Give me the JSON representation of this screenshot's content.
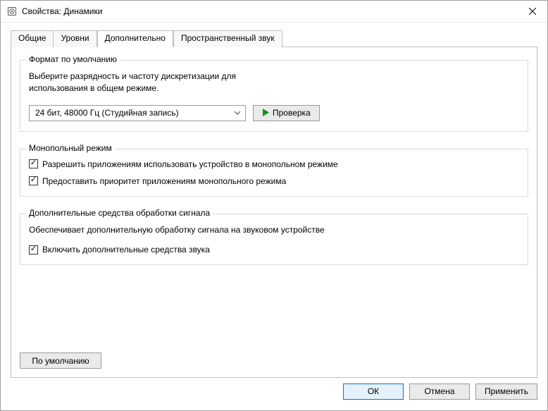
{
  "window": {
    "title": "Свойства: Динамики"
  },
  "tabs": {
    "general": "Общие",
    "levels": "Уровни",
    "advanced": "Дополнительно",
    "spatial": "Пространственный звук"
  },
  "group_format": {
    "legend": "Формат по умолчанию",
    "desc_line1": "Выберите разрядность и частоту дискретизации для",
    "desc_line2": "использования в общем режиме.",
    "selected": "24 бит, 48000 Гц (Студийная запись)",
    "test_btn": "Проверка"
  },
  "group_exclusive": {
    "legend": "Монопольный режим",
    "opt_allow": "Разрешить приложениям использовать устройство в монопольном режиме",
    "opt_priority": "Предоставить приоритет приложениям монопольного режима"
  },
  "group_enh": {
    "legend": "Дополнительные средства обработки сигнала",
    "desc": "Обеспечивает дополнительную обработку сигнала на звуковом устройстве",
    "opt_enable": "Включить дополнительные средства звука"
  },
  "panel_footer": {
    "restore_defaults": "По умолчанию"
  },
  "buttons": {
    "ok": "ОК",
    "cancel": "Отмена",
    "apply": "Применить"
  }
}
